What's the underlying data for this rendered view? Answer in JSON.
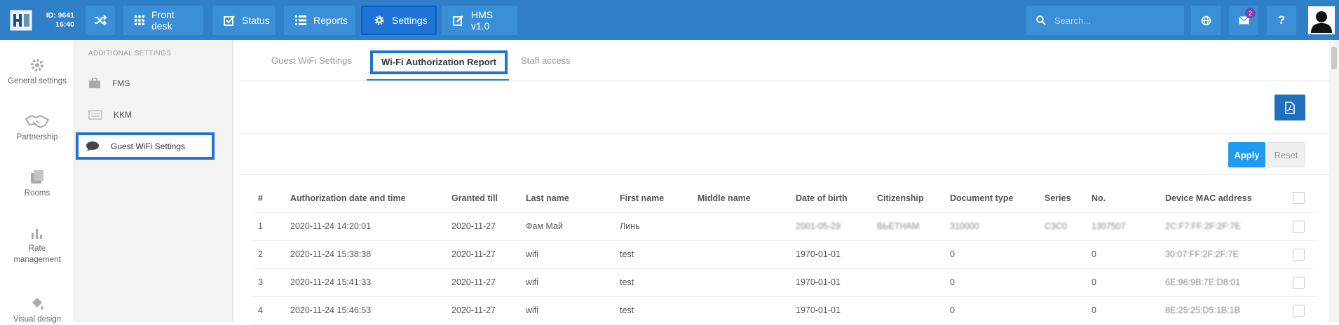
{
  "topbar": {
    "id_line": "ID: 9641",
    "time": "16:40",
    "nav": [
      {
        "label": "Front desk"
      },
      {
        "label": "Status"
      },
      {
        "label": "Reports"
      },
      {
        "label": "Settings"
      },
      {
        "label": "HMS v1.0"
      }
    ],
    "search_placeholder": "Search...",
    "mail_badge": "2",
    "help_label": "?"
  },
  "leftnav": {
    "items": [
      {
        "label": "General settings"
      },
      {
        "label": "Partnership"
      },
      {
        "label": "Rooms"
      },
      {
        "label": "Rate management"
      },
      {
        "label": "Visual design"
      }
    ]
  },
  "subnav": {
    "heading": "ADDITIONAL SETTINGS",
    "items": [
      {
        "label": "FMS"
      },
      {
        "label": "KKM"
      },
      {
        "label": "Guest WiFi Settings"
      }
    ]
  },
  "tabs": [
    {
      "label": "Guest WiFi Settings"
    },
    {
      "label": "Wi-Fi Authorization Report"
    },
    {
      "label": "Staff access"
    }
  ],
  "filters": {
    "apply_label": "Apply",
    "reset_label": "Reset"
  },
  "table": {
    "columns": [
      "#",
      "Authorization date and time",
      "Granted till",
      "Last name",
      "First name",
      "Middle name",
      "Date of birth",
      "Citizenship",
      "Document type",
      "Series",
      "No.",
      "Device MAC address"
    ],
    "rows": [
      [
        "1",
        "2020-11-24 14:20:01",
        "2020-11-27",
        "Фам Май",
        "Линь",
        "",
        "2001-05-29",
        "ВЬЕТНАМ",
        "310000",
        "C3C0",
        "1307507",
        "2C:F7:FF:2F:2F:7E"
      ],
      [
        "2",
        "2020-11-24 15:38:38",
        "2020-11-27",
        "wifi",
        "test",
        "",
        "1970-01-01",
        "",
        "0",
        "",
        "0",
        "30:07:FF:2F:2F:7E"
      ],
      [
        "3",
        "2020-11-24 15:41:33",
        "2020-11-27",
        "wifi",
        "test",
        "",
        "1970-01-01",
        "",
        "0",
        "",
        "0",
        "6E:96:9B:7E:D8:01"
      ],
      [
        "4",
        "2020-11-24 15:46:53",
        "2020-11-27",
        "wifi",
        "test",
        "",
        "1970-01-01",
        "",
        "0",
        "",
        "0",
        "8E:25:25:D5:1B:1B"
      ]
    ]
  },
  "colors": {
    "topbar": "#2f80c9",
    "highlight": "#1d74d6",
    "apply": "#1e9bf0"
  }
}
